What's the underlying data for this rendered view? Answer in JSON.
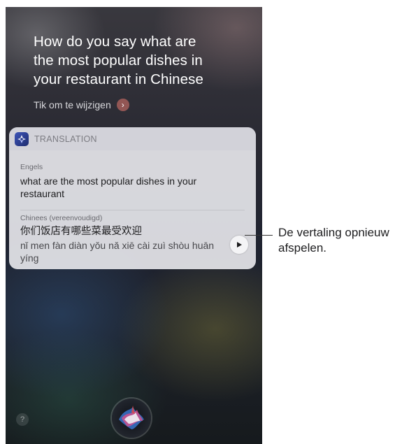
{
  "siri": {
    "query_lines": [
      "How do you say what are",
      "the most popular dishes in",
      "your restaurant in Chinese"
    ],
    "edit_label": "Tik om te wijzigen",
    "edit_icon": "chevron-right-icon",
    "help_label": "?"
  },
  "card": {
    "app_icon": "translate-compass-icon",
    "title": "TRANSLATION",
    "source_language": "Engels",
    "source_text": "what are the most popular dishes in your restaurant",
    "target_language": "Chinees (vereenvoudigd)",
    "target_text": "你们饭店有哪些菜最受欢迎",
    "pinyin": "nǐ men fàn diàn yǒu nǎ xiē cài zuì shòu huān yíng",
    "play_icon": "play-icon"
  },
  "callout": {
    "text": "De vertaling opnieuw afspelen."
  },
  "colors": {
    "card_bg": "#e6e6ea",
    "accent_icon": "#3e55b8"
  }
}
